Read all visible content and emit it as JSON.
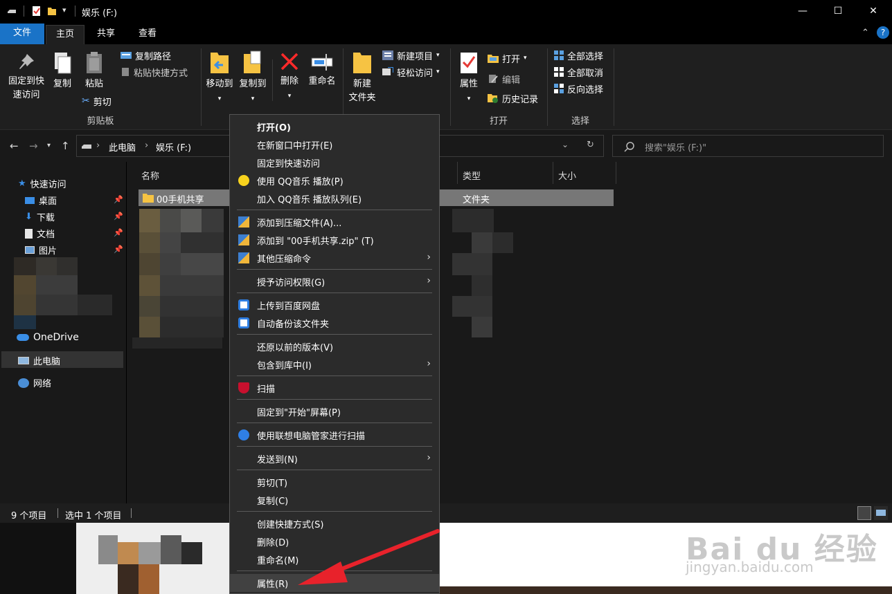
{
  "window": {
    "title": "娱乐 (F:)",
    "controls": {
      "minimize": "—",
      "maximize": "☐",
      "close": "✕"
    }
  },
  "tabs": [
    {
      "label": "文件",
      "active": false,
      "accent": true
    },
    {
      "label": "主页",
      "active": true
    },
    {
      "label": "共享"
    },
    {
      "label": "查看"
    }
  ],
  "ribbon": {
    "pin_quick_access_1": "固定到快",
    "pin_quick_access_2": "速访问",
    "copy": "复制",
    "paste": "粘贴",
    "copy_path": "复制路径",
    "paste_shortcut": "粘贴快捷方式",
    "cut": "剪切",
    "clipboard_group": "剪贴板",
    "move_to": "移动到",
    "copy_to": "复制到",
    "delete": "删除",
    "rename": "重命名",
    "new_folder_1": "新建",
    "new_folder_2": "文件夹",
    "new_item": "新建项目",
    "easy_access": "轻松访问",
    "properties": "属性",
    "open": "打开",
    "edit": "编辑",
    "history": "历史记录",
    "open_group": "打开",
    "select_all": "全部选择",
    "select_none": "全部取消",
    "invert_selection": "反向选择",
    "select_group": "选择"
  },
  "address": {
    "crumbs": [
      "此电脑",
      "娱乐 (F:)"
    ],
    "search_placeholder": "搜索\"娱乐 (F:)\""
  },
  "nav_pane": {
    "quick_access": "快速访问",
    "items": [
      "桌面",
      "下载",
      "文档",
      "图片"
    ],
    "onedrive": "OneDrive",
    "this_pc": "此电脑",
    "network": "网络"
  },
  "columns": {
    "name": "名称",
    "type": "类型",
    "size": "大小"
  },
  "selected_row": {
    "name": "00手机共享",
    "type": "文件夹"
  },
  "status": {
    "count": "9 个项目",
    "selected": "选中 1 个项目"
  },
  "context_menu": {
    "items": [
      {
        "label": "打开(O)",
        "bold": true,
        "icon": "none"
      },
      {
        "label": "在新窗口中打开(E)",
        "icon": "none"
      },
      {
        "label": "固定到快速访问",
        "icon": "none"
      },
      {
        "label": "使用 QQ音乐 播放(P)",
        "icon": "qq-music-icon"
      },
      {
        "label": "加入 QQ音乐 播放队列(E)",
        "icon": "none"
      },
      {
        "sep": true
      },
      {
        "label": "添加到压缩文件(A)...",
        "icon": "archive-icon"
      },
      {
        "label": "添加到 \"00手机共享.zip\" (T)",
        "icon": "archive-icon"
      },
      {
        "label": "其他压缩命令",
        "icon": "archive-icon",
        "submenu": true
      },
      {
        "sep": true
      },
      {
        "label": "授予访问权限(G)",
        "icon": "none",
        "submenu": true
      },
      {
        "sep": true
      },
      {
        "label": "上传到百度网盘",
        "icon": "baidu-netdisk-icon"
      },
      {
        "label": "自动备份该文件夹",
        "icon": "baidu-netdisk-icon"
      },
      {
        "sep": true
      },
      {
        "label": "还原以前的版本(V)",
        "icon": "none"
      },
      {
        "label": "包含到库中(I)",
        "icon": "none",
        "submenu": true
      },
      {
        "sep": true
      },
      {
        "label": "扫描",
        "icon": "mcafee-icon"
      },
      {
        "sep": true
      },
      {
        "label": "固定到\"开始\"屏幕(P)",
        "icon": "none"
      },
      {
        "sep": true
      },
      {
        "label": "使用联想电脑管家进行扫描",
        "icon": "lenovo-icon"
      },
      {
        "sep": true
      },
      {
        "label": "发送到(N)",
        "icon": "none",
        "submenu": true
      },
      {
        "sep": true
      },
      {
        "label": "剪切(T)",
        "icon": "none"
      },
      {
        "label": "复制(C)",
        "icon": "none"
      },
      {
        "sep": true
      },
      {
        "label": "创建快捷方式(S)",
        "icon": "none"
      },
      {
        "label": "删除(D)",
        "icon": "none"
      },
      {
        "label": "重命名(M)",
        "icon": "none"
      },
      {
        "sep": true
      },
      {
        "label": "属性(R)",
        "icon": "none",
        "highlighted": true
      }
    ]
  },
  "watermark": {
    "brand": "Bai du 经验",
    "url": "jingyan.baidu.com"
  },
  "colors": {
    "accent": "#1a73c7",
    "menu_bg": "#2b2b2b",
    "annotation_arrow": "#e8222b"
  }
}
